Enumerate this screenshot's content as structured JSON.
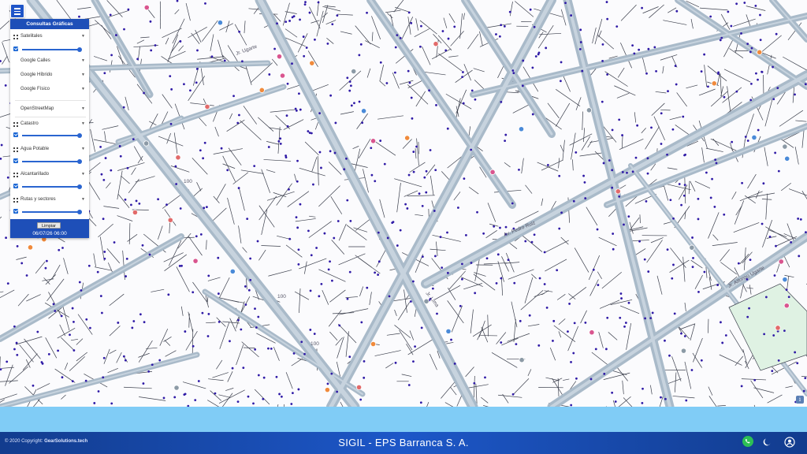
{
  "panel": {
    "title": "Consultas Gráficas",
    "basemaps": {
      "label": "Satelitales",
      "options": [
        "Google Calles",
        "Google Híbrido",
        "Google Físico",
        "OpenStreetMap"
      ]
    },
    "layers": [
      {
        "label": "Catastro",
        "checked": true
      },
      {
        "label": "Agua Potable",
        "checked": true
      },
      {
        "label": "Alcantarillado",
        "checked": true
      },
      {
        "label": "Rutas y sectores",
        "checked": true
      }
    ],
    "clear_label": "Limpiar",
    "datetime": "06/07/26 06:00"
  },
  "footer": {
    "copyright_prefix": "© 2020 Copyright:",
    "copyright_owner": "GearSolutions.tech",
    "title": "SIGIL - EPS Barranca S. A."
  },
  "map": {
    "info_symbol": "i",
    "street_labels": [
      "Jr. Ugarte",
      "Av. Pedro Ruiz",
      "Jr. Lima",
      "Jr. Alfonso Ugarte",
      "100",
      "100",
      "100"
    ],
    "icons": [
      "whatsapp-icon",
      "moon-icon",
      "user-circle-icon",
      "menu-icon",
      "info-icon"
    ],
    "colors": {
      "road": "#a9bac9",
      "network_dots": "#2f1aa6",
      "panel_header": "#1e4fb8",
      "footer": "#1d57c8",
      "band": "#80ccf6"
    }
  }
}
